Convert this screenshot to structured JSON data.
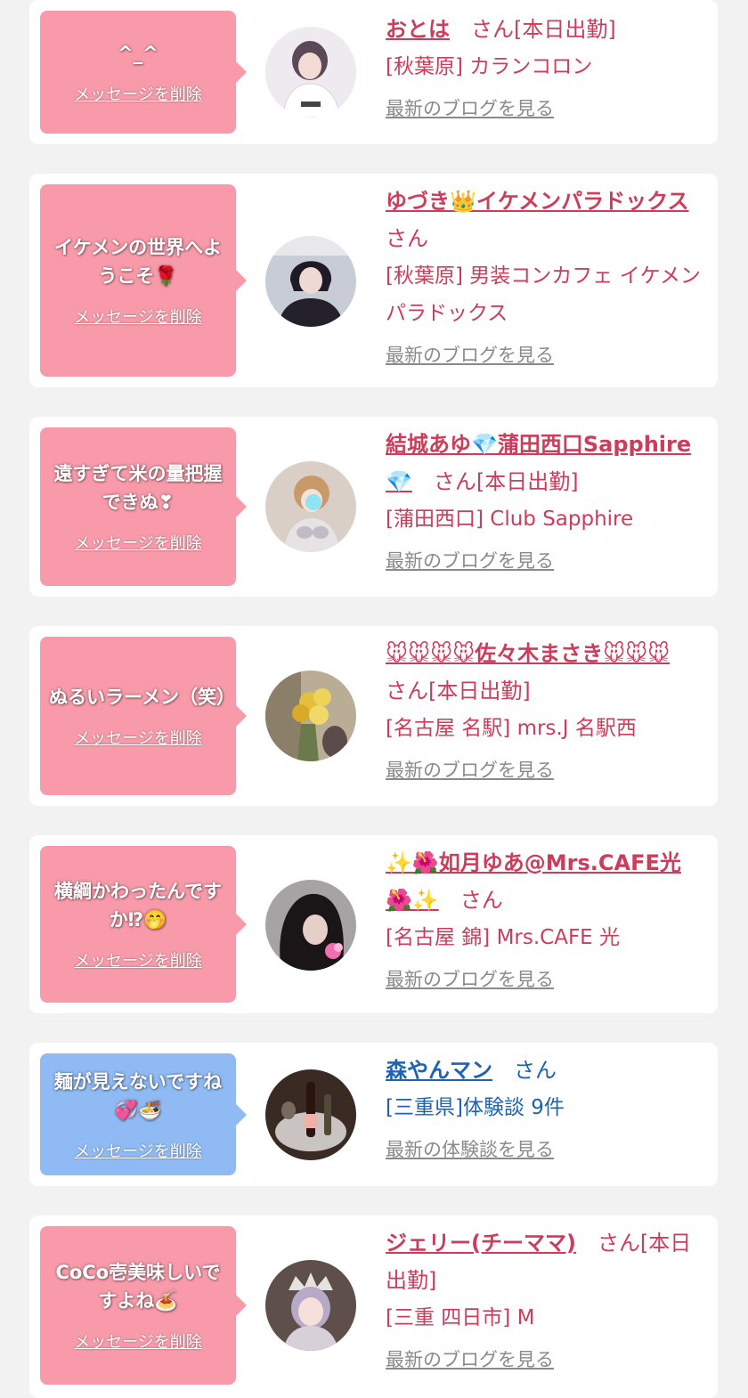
{
  "messages": [
    {
      "bubble_text": "^_^",
      "delete_label": "メッセージを削除",
      "name": "おとは",
      "honorific": "さん[本日出勤]",
      "shop": "[秋葉原] カランコロン",
      "blog_link": "最新のブログを見る",
      "theme": "pink"
    },
    {
      "bubble_text": "イケメンの世界へようこそ🌹",
      "delete_label": "メッセージを削除",
      "name": "ゆづき👑イケメンパラドックス",
      "honorific": "さん",
      "shop": "[秋葉原] 男装コンカフェ イケメンパラドックス",
      "blog_link": "最新のブログを見る",
      "theme": "pink"
    },
    {
      "bubble_text": "遠すぎて米の量把握できぬ❣",
      "delete_label": "メッセージを削除",
      "name": "結城あゆ💎蒲田西口Sapphire💎",
      "honorific": "さん[本日出勤]",
      "shop": "[蒲田西口] Club Sapphire",
      "blog_link": "最新のブログを見る",
      "theme": "pink"
    },
    {
      "bubble_text": "ぬるいラーメン（笑）",
      "delete_label": "メッセージを削除",
      "name": "🐭🐭🐭🐭佐々木まさき🐭🐭🐭",
      "honorific": "さん[本日出勤]",
      "shop": "[名古屋 名駅] mrs.J 名駅西",
      "blog_link": "最新のブログを見る",
      "theme": "pink"
    },
    {
      "bubble_text": "横綱かわったんですか⁉🤭",
      "delete_label": "メッセージを削除",
      "name": "✨🌺如月ゆあ@Mrs.CAFE光🌺✨",
      "honorific": "さん",
      "shop": "[名古屋 錦] Mrs.CAFE 光",
      "blog_link": "最新のブログを見る",
      "theme": "pink"
    },
    {
      "bubble_text": "麺が見えないですね💞🍜",
      "delete_label": "メッセージを削除",
      "name": "森やんマン",
      "honorific": "さん",
      "shop": "[三重県]体験談 9件",
      "blog_link": "最新の体験談を見る",
      "theme": "blue"
    },
    {
      "bubble_text": "CoCo壱美味しいですよね🍝",
      "delete_label": "メッセージを削除",
      "name": "ジェリー(チーママ)",
      "honorific": "さん[本日出勤]",
      "shop": "[三重 四日市] M",
      "blog_link": "最新のブログを見る",
      "theme": "pink"
    }
  ],
  "colors": {
    "page_bg": "#f2f2f2",
    "bubble_pink": "#f89aa9",
    "bubble_blue": "#8fbaf3",
    "name_pink": "#cc3d5b",
    "name_blue": "#1f63b0",
    "link_gray": "#8a8a8a"
  }
}
